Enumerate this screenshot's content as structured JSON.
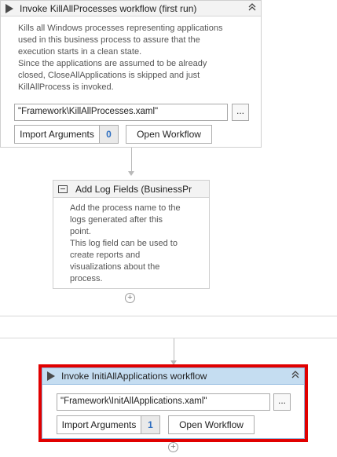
{
  "card1": {
    "title": "Invoke KillAllProcesses workflow (first run)",
    "description": "Kills all Windows processes representing applications\nused in this business process to assure that the\nexecution starts in a clean state.\nSince the applications are assumed to be already\nclosed, CloseAllApplications is skipped and just\nKillAllProcess is invoked.",
    "path": "\"Framework\\KillAllProcesses.xaml\"",
    "ellipsis": "...",
    "import_label": "Import Arguments",
    "import_count": "0",
    "open_label": "Open Workflow",
    "collapse_glyph": "⌃"
  },
  "card2": {
    "title": "Add Log Fields (BusinessPr",
    "description": "Add the process name to the\nlogs generated after this\npoint.\nThis log field can be used to\ncreate reports and\nvisualizations about the\nprocess."
  },
  "card3": {
    "title": "Invoke InitiAllApplications workflow",
    "path": "\"Framework\\InitAllApplications.xaml\"",
    "ellipsis": "...",
    "import_label": "Import Arguments",
    "import_count": "1",
    "open_label": "Open Workflow",
    "collapse_glyph": "⌃"
  },
  "icons": {
    "activity": "play-icon",
    "log": "log-fields-icon",
    "collapse": "double-chevron-up-icon",
    "add": "add-activity-icon"
  },
  "colors": {
    "highlight": "#e10000",
    "selected_header": "#c5ddf1",
    "count": "#2f6fc1"
  }
}
